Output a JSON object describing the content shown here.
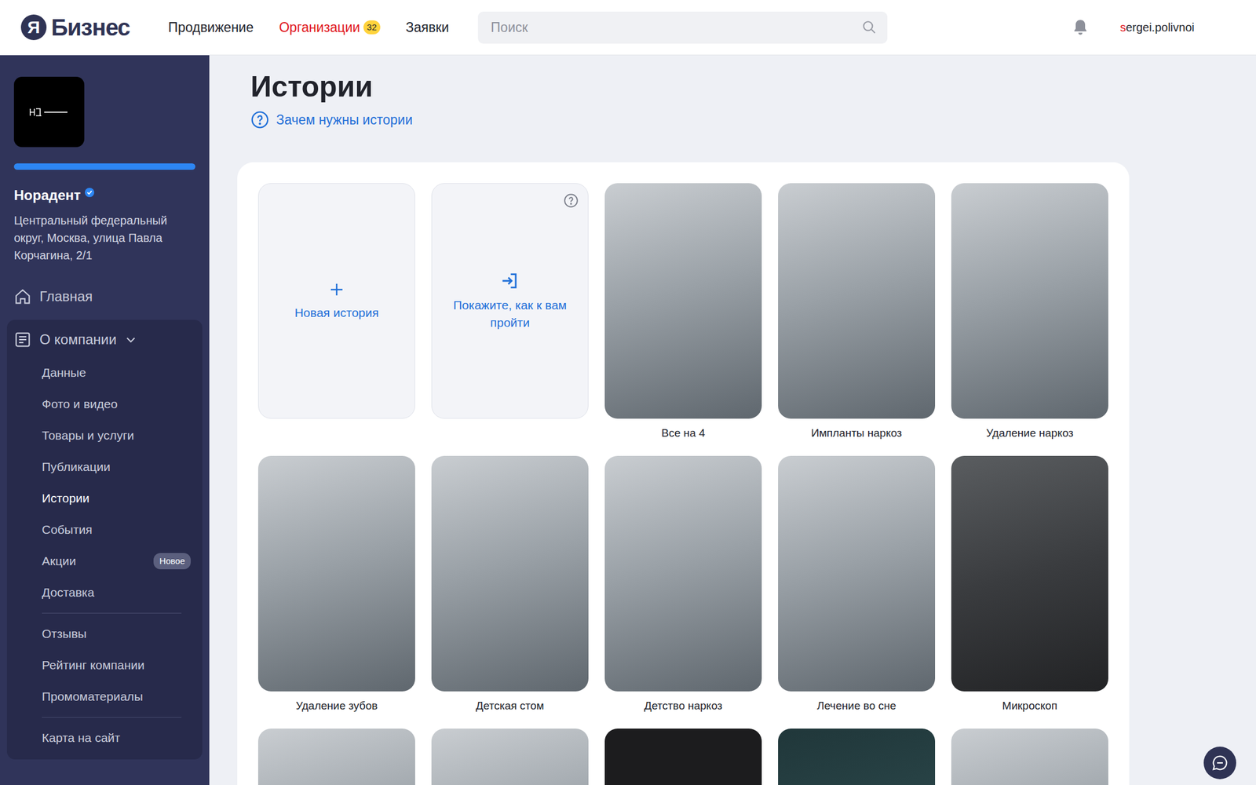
{
  "header": {
    "brand": {
      "mark": "Я",
      "name": "Бизнес"
    },
    "nav": [
      {
        "label": "Продвижение",
        "selected": false
      },
      {
        "label": "Организации",
        "selected": true,
        "badge": "32"
      },
      {
        "label": "Заявки",
        "selected": false
      }
    ],
    "search": {
      "placeholder": "Поиск"
    },
    "user": {
      "login_first": "s",
      "login_rest": "ergei.polivnoi"
    }
  },
  "sidebar": {
    "company": {
      "name": "Норадент",
      "verified": true,
      "address": "Центральный федеральный округ, Москва, улица Павла Корчагина, 2/1"
    },
    "progress": {
      "level": 1
    },
    "menu": [
      {
        "label": "Главная",
        "kind": "home",
        "selected": false
      },
      {
        "label": "О компании",
        "kind": "group",
        "expanded": true,
        "items": [
          {
            "kind": "link",
            "label": "Данные",
            "selected": false
          },
          {
            "kind": "link",
            "label": "Фото и видео",
            "selected": false
          },
          {
            "kind": "link",
            "label": "Товары и услуги",
            "selected": false
          },
          {
            "kind": "link",
            "label": "Публикации",
            "selected": false
          },
          {
            "kind": "link",
            "label": "Истории",
            "selected": true
          },
          {
            "kind": "link",
            "label": "События",
            "selected": false
          },
          {
            "kind": "link",
            "label": "Акции",
            "selected": false,
            "badge": "Новое"
          },
          {
            "kind": "link",
            "label": "Доставка",
            "selected": false
          },
          {
            "kind": "divider"
          },
          {
            "kind": "link",
            "label": "Отзывы",
            "selected": false
          },
          {
            "kind": "link",
            "label": "Рейтинг компании",
            "selected": false
          },
          {
            "kind": "link",
            "label": "Промоматериалы",
            "selected": false
          },
          {
            "kind": "divider"
          },
          {
            "kind": "link",
            "label": "Карта на сайт",
            "selected": false
          }
        ]
      }
    ]
  },
  "page": {
    "title": "Истории",
    "help_link": "Зачем нужны истории"
  },
  "actions": [
    {
      "label": "Новая история",
      "kind": "new",
      "help": false
    },
    {
      "label": "Покажите, как к вам пройти",
      "kind": "route",
      "help": true
    }
  ],
  "stories": [
    {
      "caption": "Все на 4",
      "kind": "photo"
    },
    {
      "caption": "Импланты наркоз",
      "kind": "photo"
    },
    {
      "caption": "Удаление наркоз",
      "kind": "photo"
    },
    {
      "caption": "Удаление зубов",
      "kind": "photo"
    },
    {
      "caption": "Детская стом",
      "kind": "photo"
    },
    {
      "caption": "Детство наркоз",
      "kind": "photo"
    },
    {
      "caption": "Лечение во сне",
      "kind": "photo"
    },
    {
      "caption": "Микроскоп",
      "kind": "dark-photo"
    },
    {
      "kind": "photo"
    },
    {
      "kind": "photo"
    },
    {
      "kind": "dark"
    },
    {
      "kind": "teal"
    },
    {
      "kind": "photo"
    }
  ]
}
